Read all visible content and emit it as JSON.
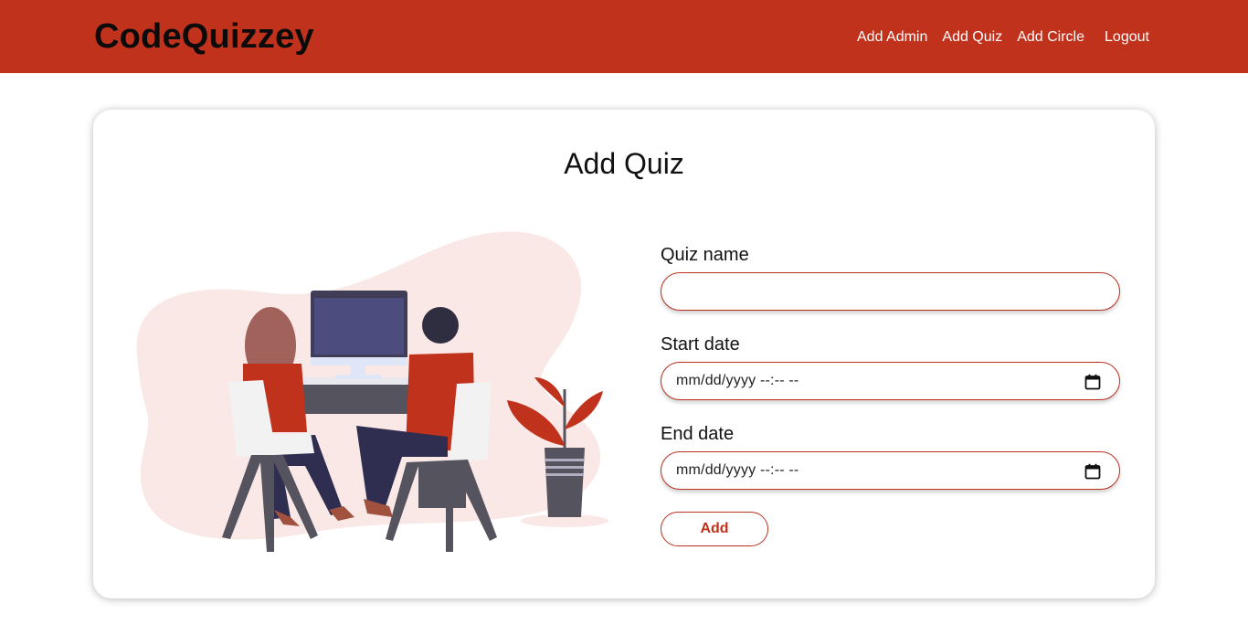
{
  "navbar": {
    "brand": "CodeQuizzey",
    "links": [
      {
        "label": "Add Admin"
      },
      {
        "label": "Add Quiz"
      },
      {
        "label": "Add Circle"
      },
      {
        "label": "Logout"
      }
    ]
  },
  "page": {
    "title": "Add Quiz"
  },
  "form": {
    "quiz_name": {
      "label": "Quiz name",
      "value": ""
    },
    "start_date": {
      "label": "Start date",
      "value": "mm/dd/yyyy --:-- --",
      "icon": "calendar-icon"
    },
    "end_date": {
      "label": "End date",
      "value": "mm/dd/yyyy --:-- --",
      "icon": "calendar-icon"
    },
    "submit_label": "Add"
  },
  "colors": {
    "brand": "#c1321d",
    "illustration_shirt": "#c1321d",
    "illustration_blob": "#f9e8e6"
  }
}
